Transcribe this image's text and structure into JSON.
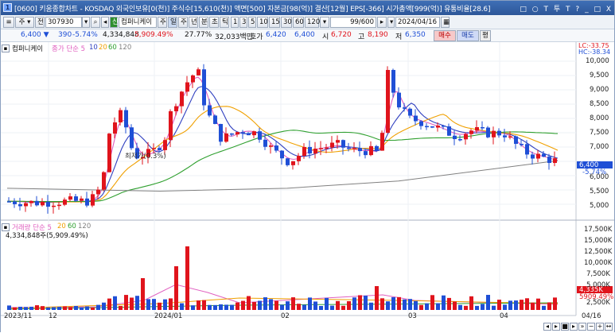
{
  "title": {
    "icon_label": "1",
    "text": "[0600] 키움종합차트 - KOSDAQ 외국인보유[0(천)] 주식수[15,610(천)] 액면[500] 자본금[98(억)] 결산[12월] EPS[-366] 시가총액[999(억)] 유통비율[28.6]",
    "controls": [
      "□",
      "○",
      "T",
      "투",
      "T",
      "?",
      "_",
      "□",
      "X"
    ]
  },
  "toolbar": {
    "stock_code": "307930",
    "stock_name": "컴퍼니케이",
    "search_icon": "search-icon",
    "tabs": [
      "주",
      "일",
      "주",
      "년",
      "분",
      "초",
      "틱"
    ],
    "periods": [
      "1",
      "3",
      "5",
      "10",
      "15",
      "30",
      "60",
      "120"
    ],
    "count": "99/600",
    "date": "2024/04/16"
  },
  "info": {
    "price": "6,400",
    "change": "390",
    "change_pct": "-5.74%",
    "volume": "4,334,848",
    "volume_pct": "5,909.49%",
    "turnover": "27.77%",
    "amount": "32,033백만",
    "quote_label": "호가",
    "quote": "6,420",
    "quote2": "6,400",
    "open_label": "시",
    "open": "6,720",
    "high_label": "고",
    "high": "8,190",
    "low_label": "저",
    "low": "6,350",
    "buy_label": "매수",
    "sell_label": "매도",
    "flat_label": "평"
  },
  "chart_labels": {
    "stock_name": "컴퍼니케이",
    "ma_legend": "종가 단순 5",
    "ma_periods": [
      "10",
      "20",
      "60",
      "120"
    ],
    "lc": "LC:-33.75",
    "hc": "HC:-38.34",
    "low_annot": "최저가(0.3%)",
    "current_price": "6,400",
    "current_pct": "-5.74%",
    "volume_legend": "거래량 단순 5",
    "volume_ma_periods": [
      "20",
      "60",
      "120"
    ],
    "volume_value": "4,334,848주(5,909.49%)",
    "volume_current": "4,335K",
    "volume_current_pct": "5909.49%"
  },
  "axis": {
    "price_ticks": [
      "10,000",
      "9,500",
      "9,000",
      "8,500",
      "8,000",
      "7,500",
      "7,000",
      "6,500",
      "6,000",
      "5,500",
      "5,000"
    ],
    "volume_ticks": [
      "17,500K",
      "15,000K",
      "12,500K",
      "10,000K",
      "7,500K",
      "5,000K",
      "2,500K"
    ],
    "x_ticks": [
      "2023/11",
      "12",
      "2024/01",
      "02",
      "03",
      "04",
      "04/16"
    ]
  },
  "colors": {
    "up": "#e0141c",
    "down": "#1f4fd6",
    "ma5": "#e060c0",
    "ma10": "#3040c0",
    "ma20": "#f0a000",
    "ma60": "#30a030",
    "ma120": "#808080"
  }
}
